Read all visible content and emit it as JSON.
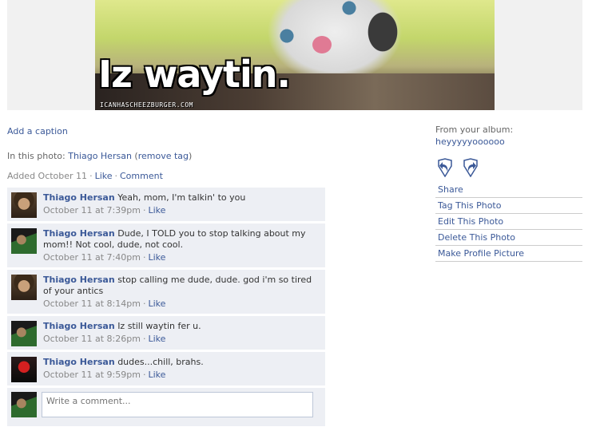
{
  "photo": {
    "meme_text": "Iz waytin.",
    "credit": "ICANHASCHEEZBURGER.COM"
  },
  "caption": {
    "add_label": "Add a caption"
  },
  "in_photo": {
    "prefix": "In this photo: ",
    "person": "Thiago Hersan",
    "remove_tag": "remove tag"
  },
  "added": {
    "date": "Added October 11",
    "like": "Like",
    "comment": "Comment"
  },
  "comments": [
    {
      "author": "Thiago Hersan",
      "text": "Yeah, mom, I'm talkin' to you",
      "time": "October 11 at 7:39pm",
      "like": "Like"
    },
    {
      "author": "Thiago Hersan",
      "text": "Dude, I TOLD you to stop talking about my mom!! Not cool, dude, not cool.",
      "time": "October 11 at 7:40pm",
      "like": "Like"
    },
    {
      "author": "Thiago Hersan",
      "text": "stop calling me dude, dude. god i'm so tired of your antics",
      "time": "October 11 at 8:14pm",
      "like": "Like"
    },
    {
      "author": "Thiago Hersan",
      "text": "Iz still waytin fer u.",
      "time": "October 11 at 8:26pm",
      "like": "Like"
    },
    {
      "author": "Thiago Hersan",
      "text": "dudes...chill, brahs.",
      "time": "October 11 at 9:59pm",
      "like": "Like"
    }
  ],
  "write_comment": {
    "placeholder": "Write a comment..."
  },
  "sidebar": {
    "from_label": "From your album:",
    "album_name": "heyyyyyoooooo",
    "actions": {
      "share": "Share",
      "tag": "Tag This Photo",
      "edit": "Edit This Photo",
      "delete": "Delete This Photo",
      "profile": "Make Profile Picture"
    }
  },
  "colors": {
    "link": "#3b5998",
    "comment_bg": "#edeff4"
  },
  "icons": {
    "rotate_left": "rotate-left-icon",
    "rotate_right": "rotate-right-icon"
  }
}
